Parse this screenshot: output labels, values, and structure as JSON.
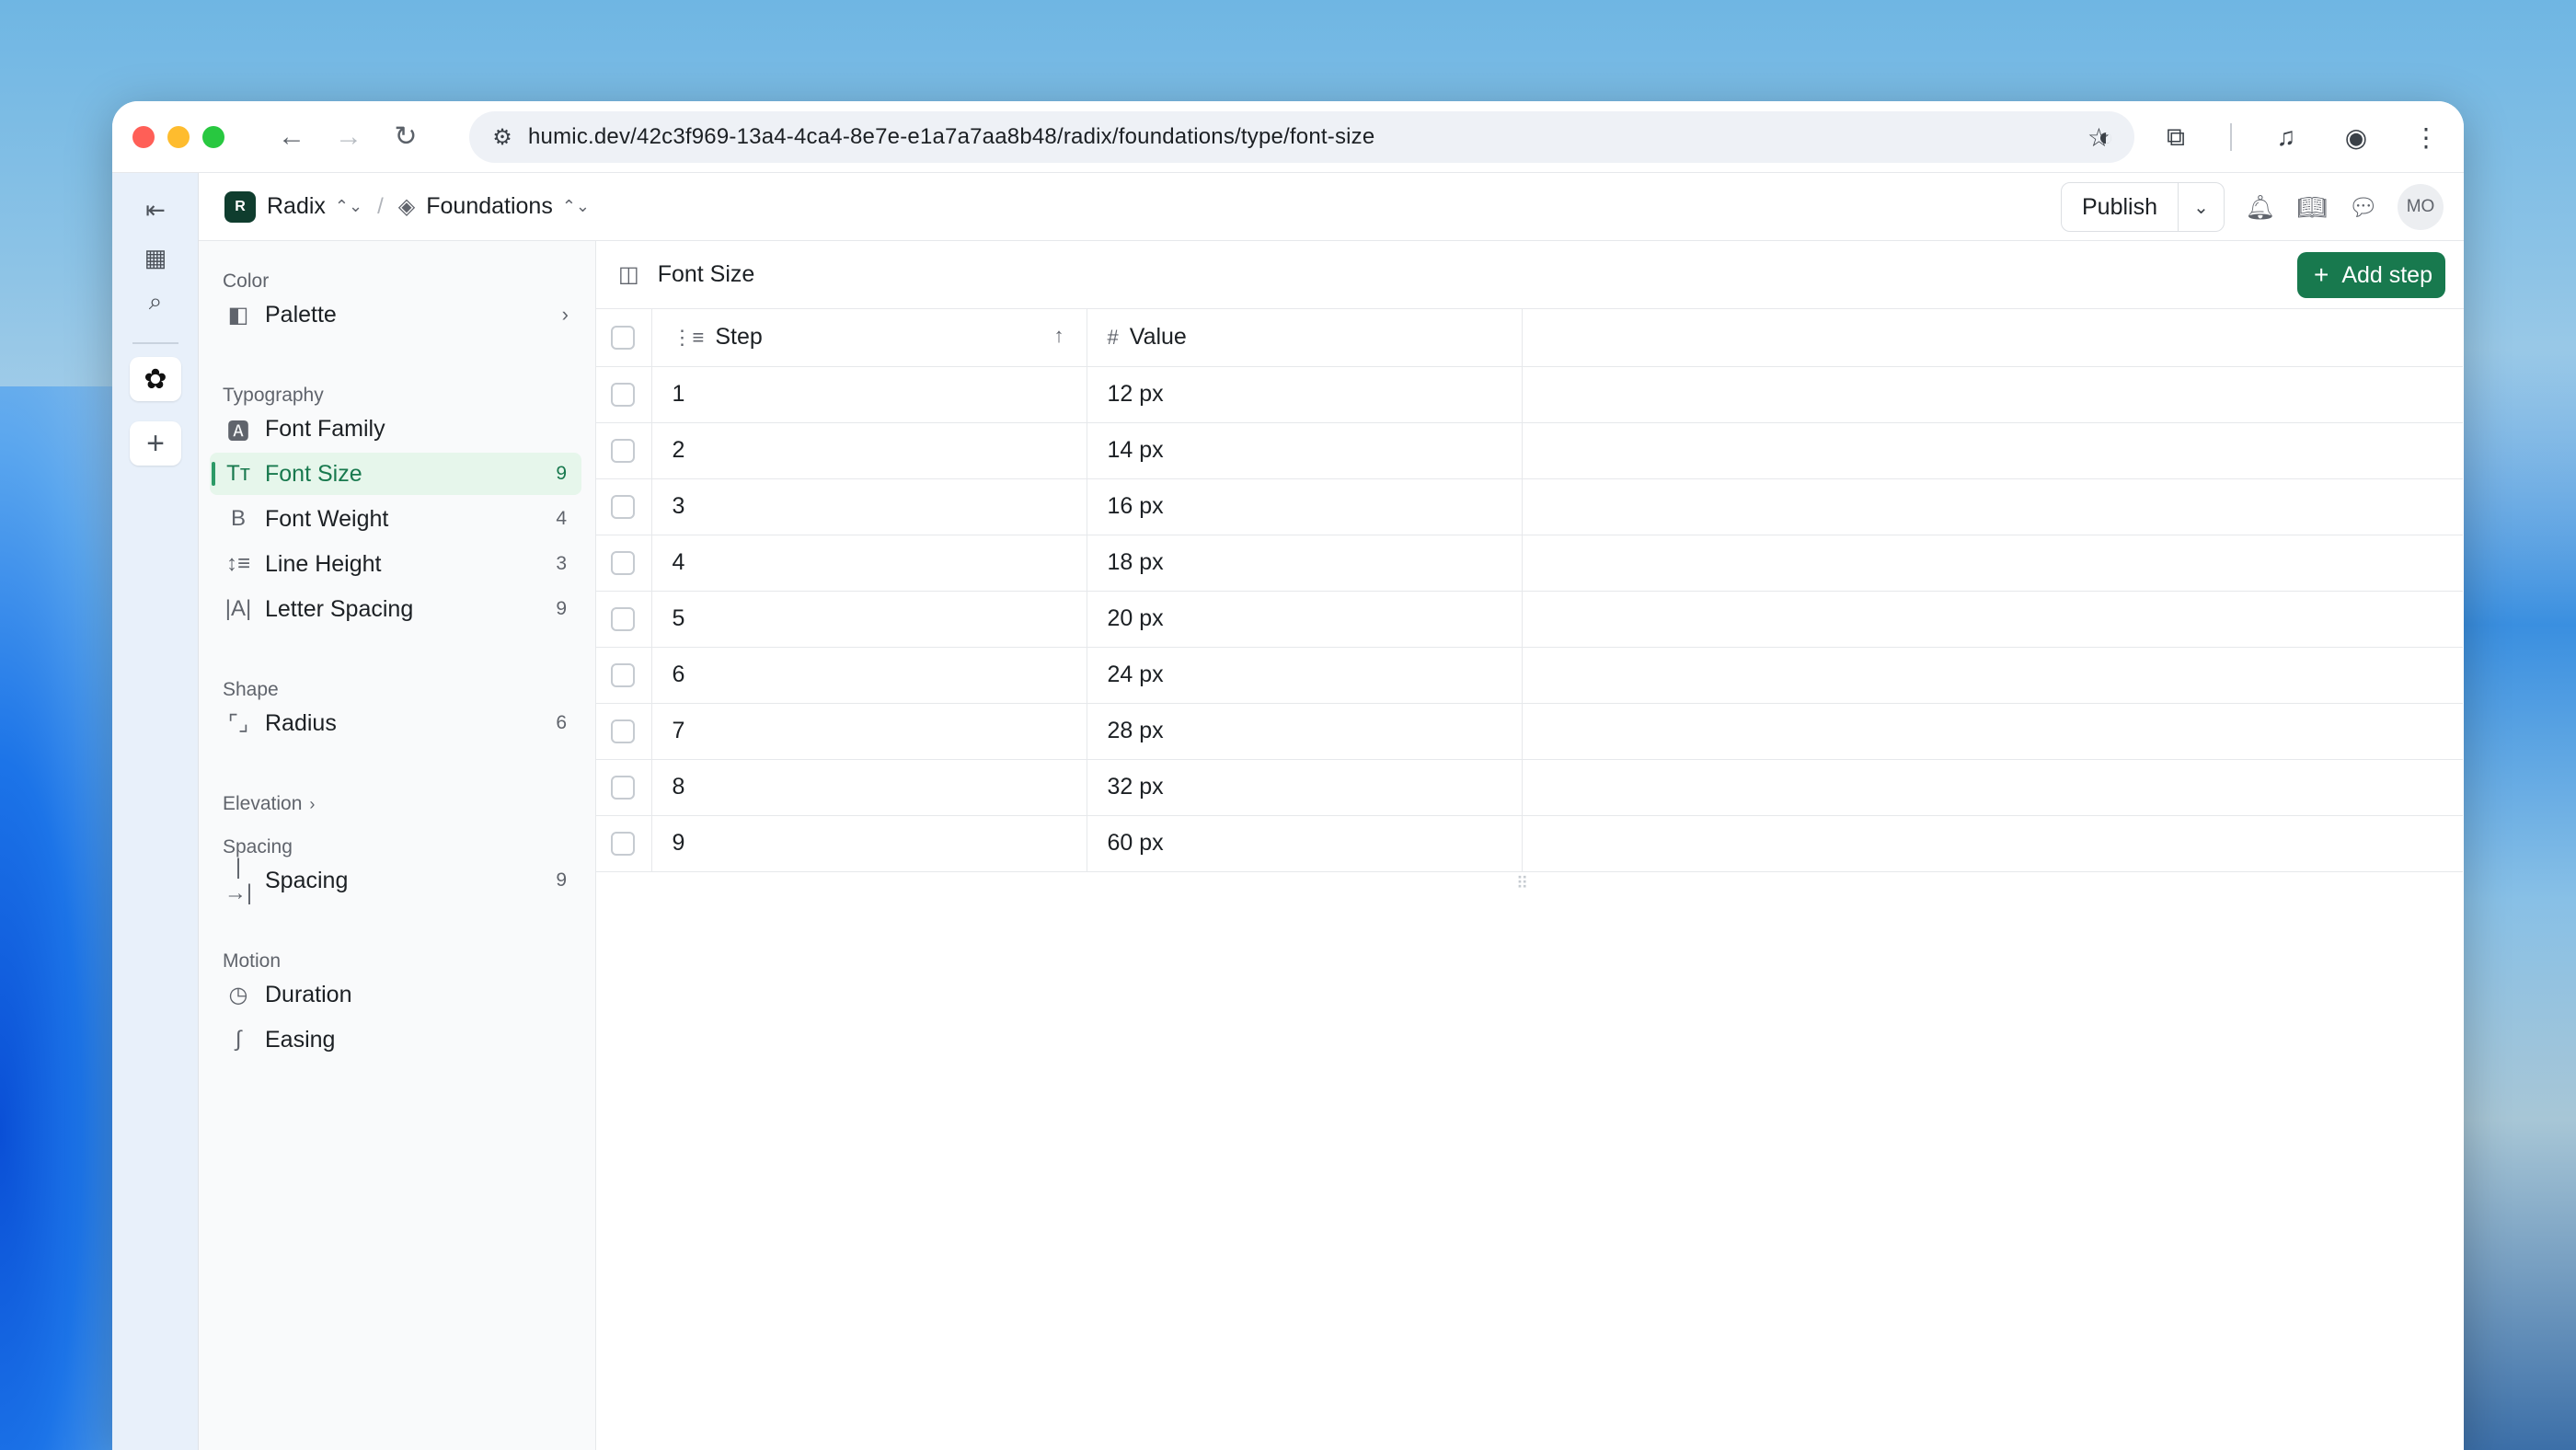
{
  "browser": {
    "url": "humic.dev/42c3f969-13a4-4ca4-8e7e-e1a7a7aa8b48/radix/foundations/type/font-size"
  },
  "topbar": {
    "workspace_badge": "R",
    "workspace_name": "Radix",
    "section_name": "Foundations",
    "publish_label": "Publish",
    "avatar_initials": "MO"
  },
  "sidebar": {
    "sections": {
      "color": "Color",
      "typography": "Typography",
      "shape": "Shape",
      "elevation": "Elevation",
      "spacing": "Spacing",
      "motion": "Motion"
    },
    "items": {
      "palette": {
        "label": "Palette"
      },
      "font_family": {
        "label": "Font Family"
      },
      "font_size": {
        "label": "Font Size",
        "count": "9"
      },
      "font_weight": {
        "label": "Font Weight",
        "count": "4"
      },
      "line_height": {
        "label": "Line Height",
        "count": "3"
      },
      "letter_spacing": {
        "label": "Letter Spacing",
        "count": "9"
      },
      "radius": {
        "label": "Radius",
        "count": "6"
      },
      "spacing": {
        "label": "Spacing",
        "count": "9"
      },
      "duration": {
        "label": "Duration"
      },
      "easing": {
        "label": "Easing"
      }
    }
  },
  "main": {
    "title": "Font Size",
    "add_button": "Add step",
    "columns": {
      "step": "Step",
      "value": "Value"
    },
    "rows": [
      {
        "step": "1",
        "value": "12 px"
      },
      {
        "step": "2",
        "value": "14 px"
      },
      {
        "step": "3",
        "value": "16 px"
      },
      {
        "step": "4",
        "value": "18 px"
      },
      {
        "step": "5",
        "value": "20 px"
      },
      {
        "step": "6",
        "value": "24 px"
      },
      {
        "step": "7",
        "value": "28 px"
      },
      {
        "step": "8",
        "value": "32 px"
      },
      {
        "step": "9",
        "value": "60 px"
      }
    ]
  },
  "colors": {
    "accent": "#18794e",
    "active_bg": "#e6f6eb",
    "rail_bg": "#e8f0fa"
  }
}
